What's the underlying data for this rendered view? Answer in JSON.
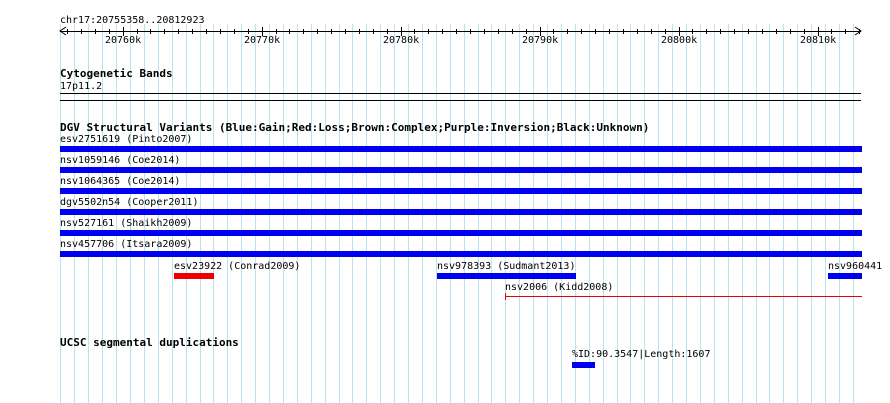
{
  "ruler": {
    "position": "chr17:20755358..20812923",
    "ticks": [
      "20760k",
      "20770k",
      "20780k",
      "20790k",
      "20800k",
      "20810k"
    ]
  },
  "cytoband": {
    "title": "Cytogenetic Bands",
    "band": "17p11.2"
  },
  "dgv": {
    "title": "DGV Structural Variants (Blue:Gain;Red:Loss;Brown:Complex;Purple:Inversion;Black:Unknown)",
    "colors": {
      "gain": "#0000ee",
      "loss": "#ee0000"
    },
    "features": [
      {
        "label": "esv2751619 (Pinto2007)",
        "type": "gain",
        "style": "bar"
      },
      {
        "label": "nsv1059146 (Coe2014)",
        "type": "gain",
        "style": "bar"
      },
      {
        "label": "nsv1064365 (Coe2014)",
        "type": "gain",
        "style": "bar"
      },
      {
        "label": "dgv5502n54 (Cooper2011)",
        "type": "gain",
        "style": "bar"
      },
      {
        "label": "nsv527161 (Shaikh2009)",
        "type": "gain",
        "style": "bar"
      },
      {
        "label": "nsv457706 (Itsara2009)",
        "type": "gain",
        "style": "bar"
      },
      {
        "label": "esv23922 (Conrad2009)",
        "type": "loss",
        "style": "bar"
      },
      {
        "label": "nsv978393 (Sudmant2013)",
        "type": "gain",
        "style": "bar"
      },
      {
        "label": "nsv960441",
        "type": "gain",
        "style": "bar"
      },
      {
        "label": "nsv2006 (Kidd2008)",
        "type": "loss",
        "style": "line"
      }
    ]
  },
  "segdups": {
    "title": "UCSC segmental duplications",
    "color": "#0000ee",
    "features": [
      {
        "label": "%ID:90.3547|Length:1607"
      }
    ]
  }
}
